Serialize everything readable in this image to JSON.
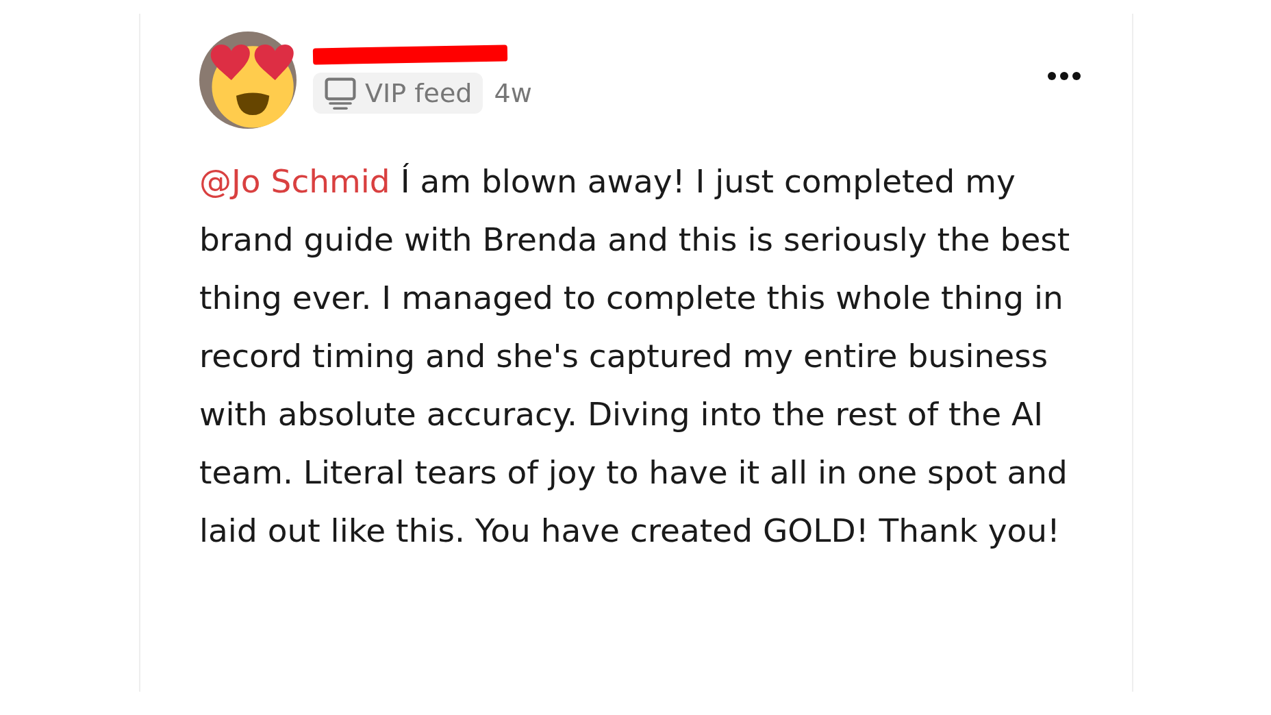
{
  "post": {
    "author_redacted": true,
    "feed_badge": {
      "label": "VIP feed"
    },
    "time": "4w",
    "mention": "@Jo Schmid",
    "text": "Í am blown away! I just completed my brand guide with Brenda and this is seriously the best thing ever. I managed to complete this whole thing in record timing and she's captured my entire business with absolute accuracy. Diving into the rest of the AI team. Literal tears of joy to have it all in one spot and laid out like this. You have created GOLD! Thank you!"
  }
}
